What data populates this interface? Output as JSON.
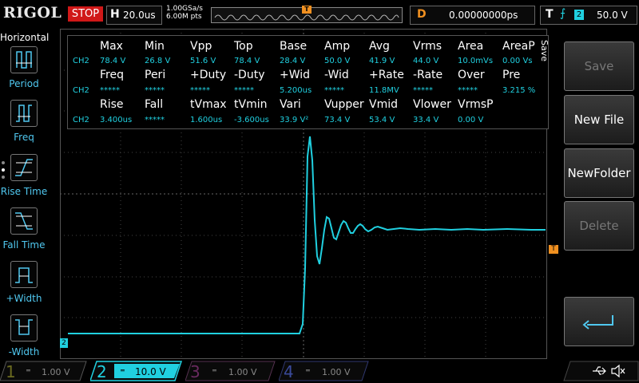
{
  "top": {
    "brand": "RIGOL",
    "run_state": "STOP",
    "timebase_label": "H",
    "timebase_value": "20.0us",
    "sample_rate": "1.00GSa/s",
    "memory_depth": "6.00M pts",
    "trigger_marker": "T",
    "delay_label": "D",
    "delay_value": "0.00000000ps",
    "trigger_label": "T",
    "trigger_source": "2",
    "trigger_level": "50.0 V"
  },
  "left_menu": {
    "title": "Horizontal",
    "items": [
      {
        "label": "Period"
      },
      {
        "label": "Freq"
      },
      {
        "label": "Rise Time"
      },
      {
        "label": "Fall Time"
      },
      {
        "label": "+Width"
      },
      {
        "label": "-Width"
      }
    ]
  },
  "measurements": {
    "row1_headers": [
      "Max",
      "Min",
      "Vpp",
      "Top",
      "Base",
      "Amp",
      "Avg",
      "Vrms",
      "Area",
      "AreaP"
    ],
    "row1_channel": "CH2",
    "row1_values": [
      "78.4 V",
      "26.8 V",
      "51.6 V",
      "78.4 V",
      "28.4 V",
      "50.0 V",
      "41.9 V",
      "44.0 V",
      "10.0mVs",
      "0.00 Vs"
    ],
    "row2_headers": [
      "Freq",
      "Peri",
      "+Duty",
      "-Duty",
      "+Wid",
      "-Wid",
      "+Rate",
      "-Rate",
      "Over",
      "Pre"
    ],
    "row2_channel": "CH2",
    "row2_values": [
      "*****",
      "*****",
      "*****",
      "*****",
      "5.200us",
      "*****",
      "11.8MV",
      "*****",
      "*****",
      "3.215 %"
    ],
    "row3_headers": [
      "Rise",
      "Fall",
      "tVmax",
      "tVmin",
      "Vari",
      "Vupper",
      "Vmid",
      "Vlower",
      "VrmsP"
    ],
    "row3_channel": "CH2",
    "row3_values": [
      "3.400us",
      "*****",
      "1.600us",
      "-3.600us",
      "33.9 V²",
      "73.4 V",
      "53.4 V",
      "33.4 V",
      "0.00 V"
    ]
  },
  "right_menu": {
    "tab": "Save",
    "buttons": [
      {
        "label": "Save",
        "enabled": false
      },
      {
        "label": "New File",
        "enabled": true
      },
      {
        "label": "NewFolder",
        "enabled": true
      },
      {
        "label": "Delete",
        "enabled": false
      }
    ],
    "return_icon": "return-arrow-icon"
  },
  "markers": {
    "trigger_level_marker": "T",
    "channel_ground_marker": "2"
  },
  "channels": [
    {
      "number": "1",
      "scale": "1.00 V",
      "color": "#e0e020",
      "active": false
    },
    {
      "number": "2",
      "scale": "10.0 V",
      "color": "#20d0e0",
      "active": true
    },
    {
      "number": "3",
      "scale": "1.00 V",
      "color": "#e040c0",
      "active": false
    },
    {
      "number": "4",
      "scale": "1.00 V",
      "color": "#3050f0",
      "active": false
    }
  ],
  "status_icons": [
    "usb-icon",
    "speaker-mute-icon"
  ],
  "colors": {
    "ch2": "#20d0e0",
    "accent_menu": "#50c8f0",
    "stop": "#d01818",
    "delay": "#f09020"
  }
}
